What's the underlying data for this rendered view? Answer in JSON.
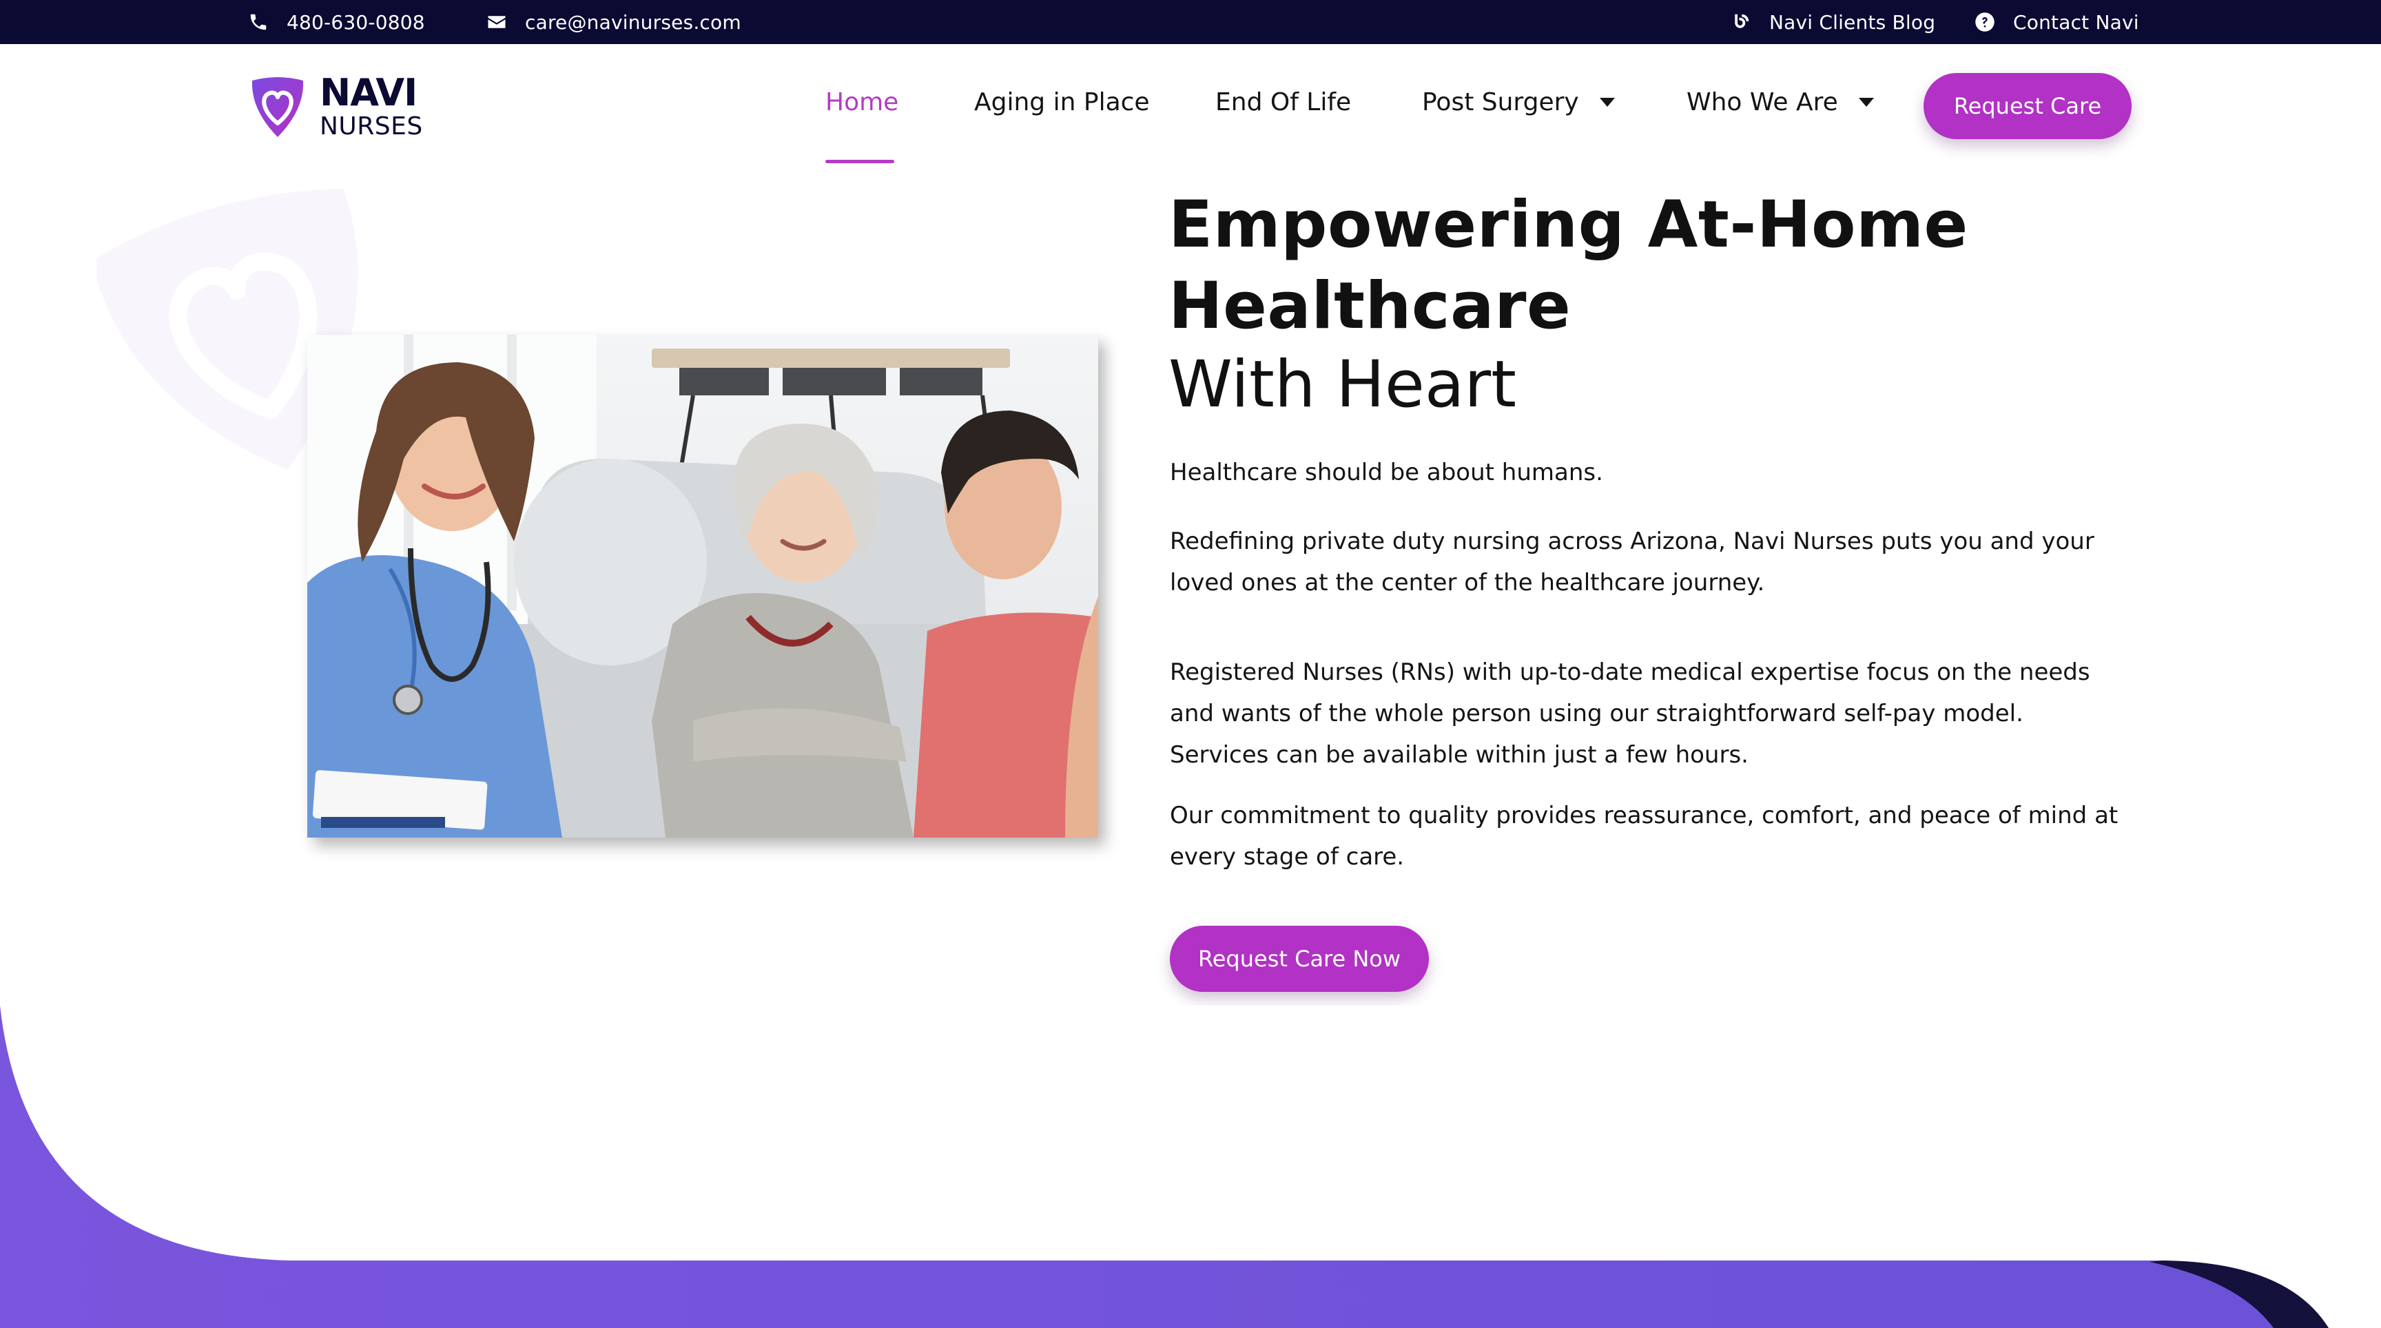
{
  "topbar": {
    "phone": "480-630-0808",
    "email": "care@navinurses.com",
    "blog": "Navi Clients Blog",
    "contact": "Contact Navi"
  },
  "logo": {
    "line1": "NAVI",
    "line2": "NURSES"
  },
  "nav": {
    "items": [
      {
        "label": "Home",
        "active": true
      },
      {
        "label": "Aging in Place"
      },
      {
        "label": "End Of Life"
      },
      {
        "label": "Post Surgery",
        "dropdown": true
      },
      {
        "label": "Who We Are",
        "dropdown": true
      }
    ],
    "cta": "Request Care"
  },
  "hero": {
    "title_bold": "Empowering At-Home Healthcare",
    "title_light": "With Heart",
    "p1": "Healthcare should be about humans.",
    "p2": "Redefining private duty nursing across Arizona, Navi Nurses puts you and your loved ones at the center of the healthcare journey.",
    "p3": "Registered Nurses (RNs) with up-to-date medical expertise focus on the needs and wants of the whole person using our straightforward self-pay model. Services can be available within just a few hours.",
    "p4": "Our commitment to quality provides reassurance, comfort, and peace of mind at every stage of care.",
    "cta": "Request Care Now"
  },
  "colors": {
    "topbar": "#0b0a33",
    "accent": "#b132c4",
    "nav_active": "#b43bc7",
    "purple_band": "#6f54d9"
  },
  "icons": [
    "phone-icon",
    "email-icon",
    "blog-icon",
    "help-icon",
    "chevron-down-icon"
  ]
}
